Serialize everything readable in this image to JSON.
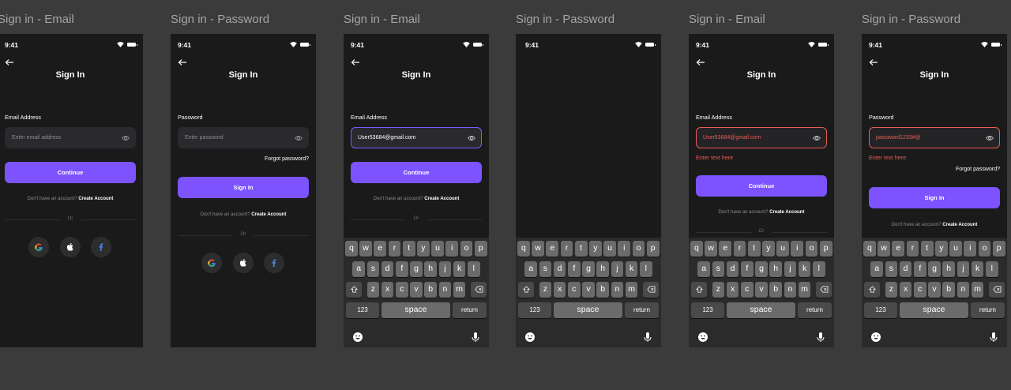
{
  "frames": [
    {
      "title": "Sign in - Email"
    },
    {
      "title": "Sign in - Password"
    },
    {
      "title": "Sign in - Email"
    },
    {
      "title": "Sign in - Password"
    },
    {
      "title": "Sign in - Email"
    },
    {
      "title": "Sign in - Password"
    }
  ],
  "status": {
    "time": "9:41"
  },
  "screen": {
    "title": "Sign In",
    "email_label": "Email Address",
    "email_placeholder": "Enter email address",
    "email_value": "User53684@gmail.com",
    "password_label": "Password",
    "password_placeholder": "Enter password",
    "password_value": "password1233#@",
    "error_text": "Enter text here",
    "forgot": "Forgot password?",
    "continue": "Continue",
    "sign_in": "Sign In",
    "no_account": "Don't have an account?",
    "create_account": "Create Account",
    "or": "Or"
  },
  "keyboard": {
    "row1": [
      "q",
      "w",
      "e",
      "r",
      "t",
      "y",
      "u",
      "i",
      "o",
      "p"
    ],
    "row2": [
      "a",
      "s",
      "d",
      "f",
      "g",
      "h",
      "j",
      "k",
      "l"
    ],
    "row3": [
      "z",
      "x",
      "c",
      "v",
      "b",
      "n",
      "m"
    ],
    "numbers": "123",
    "space": "space",
    "return": "return"
  },
  "colors": {
    "accent": "#7c53ff",
    "error": "#e85c56",
    "background": "#1a1a1a"
  }
}
